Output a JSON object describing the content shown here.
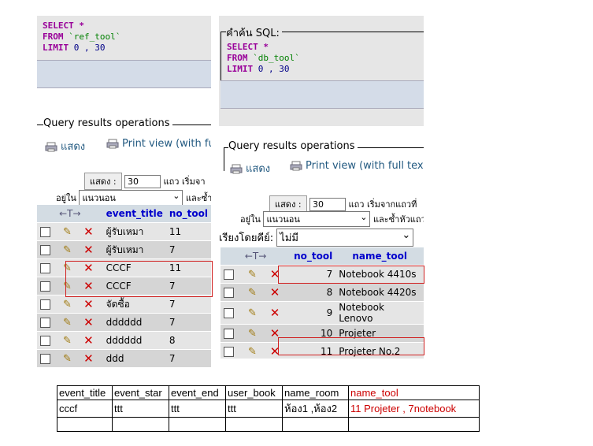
{
  "left": {
    "sql": {
      "select": "SELECT",
      "star": "*",
      "from": "FROM",
      "table": "`ref_tool`",
      "limit": "LIMIT",
      "offset": "0",
      "comma": ",",
      "count": "30"
    },
    "qro_title": "Query results operations",
    "print_label": "แสดง",
    "printview_label": "Print view (with fu",
    "show_btn": "แสดง :",
    "show_value": "30",
    "rows_start": "แถว เริ่มจา",
    "in_label": "อยู่ใน",
    "mode_value": "แนวนอน",
    "repeat_label": "และซ้ำ",
    "columns": [
      "event_title",
      "no_tool"
    ],
    "rows": [
      {
        "event_title": "ผู้รับเหมา",
        "no_tool": "11"
      },
      {
        "event_title": "ผู้รับเหมา",
        "no_tool": "7"
      },
      {
        "event_title": "CCCF",
        "no_tool": "11"
      },
      {
        "event_title": "CCCF",
        "no_tool": "7"
      },
      {
        "event_title": "จัดซื้อ",
        "no_tool": "7"
      },
      {
        "event_title": "dddddd",
        "no_tool": "7"
      },
      {
        "event_title": "dddddd",
        "no_tool": "8"
      },
      {
        "event_title": "ddd",
        "no_tool": "7"
      }
    ]
  },
  "right": {
    "sql_legend": "คำค้น SQL:",
    "sql": {
      "select": "SELECT",
      "star": "*",
      "from": "FROM",
      "table": "`db_tool`",
      "limit": "LIMIT",
      "offset": "0",
      "comma": ",",
      "count": "30"
    },
    "qro_title": "Query results operations",
    "print_label": "แสดง",
    "printview_label": "Print view (with full text",
    "show_btn": "แสดง :",
    "show_value": "30",
    "rows_start": "แถว เริ่มจากแถวที่",
    "in_label": "อยู่ใน",
    "mode_value": "แนวนอน",
    "repeat_label": "และซ้ำหัวแถว",
    "sortkey_label": "เรียงโดยคีย์:",
    "sortkey_value": "ไม่มี",
    "columns": [
      "no_tool",
      "name_tool"
    ],
    "rows": [
      {
        "no_tool": "7",
        "name_tool": "Notebook 4410s"
      },
      {
        "no_tool": "8",
        "name_tool": "Notebook 4420s"
      },
      {
        "no_tool": "9",
        "name_tool": "Notebook Lenovo"
      },
      {
        "no_tool": "10",
        "name_tool": "Projeter"
      },
      {
        "no_tool": "11",
        "name_tool": "Projeter No.2"
      }
    ]
  },
  "bottom": {
    "headers": [
      "event_title",
      "event_star",
      "event_end",
      "user_book",
      "name_room",
      "name_tool"
    ],
    "row": [
      "cccf",
      "ttt",
      "ttt",
      "ttt",
      "ห้อง1 ,ห้อง2",
      "11 Projeter , 7notebook"
    ]
  },
  "colors": {
    "highlight": "#d02020",
    "header_bg": "#d3dce3",
    "link": "#235a81"
  }
}
